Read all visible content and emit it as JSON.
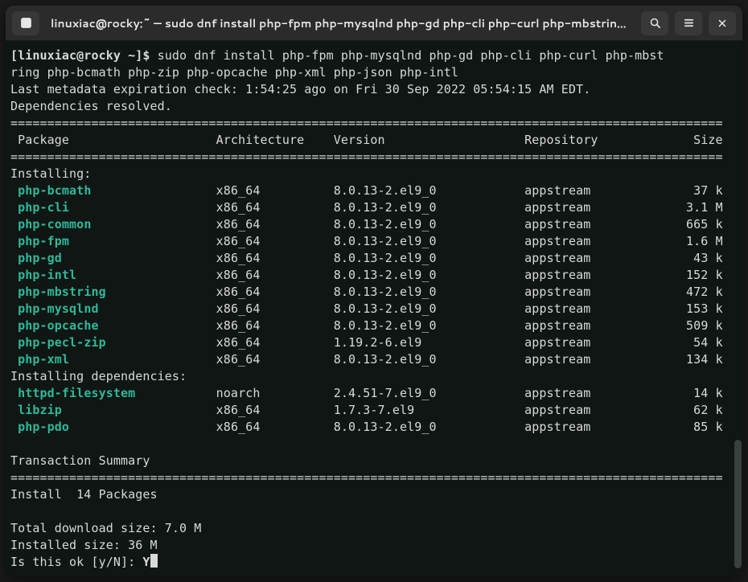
{
  "titlebar": {
    "title": "linuxiac@rocky:~ — sudo dnf install php-fpm php-mysqlnd php-gd php-cli php-curl php-mbstring p…"
  },
  "prompt": {
    "label": "[linuxiac@rocky ~]$",
    "command_line1": " sudo dnf install php-fpm php-mysqlnd php-gd php-cli php-curl php-mbst",
    "command_line2": "ring php-bcmath php-zip php-opcache php-xml php-json php-intl"
  },
  "meta_line": "Last metadata expiration check: 1:54:25 ago on Fri 30 Sep 2022 05:54:15 AM EDT.",
  "deps_resolved": "Dependencies resolved.",
  "header": {
    "package": " Package",
    "arch": "Architecture",
    "version": "Version",
    "repo": "Repository",
    "size": "Size"
  },
  "section_installing": "Installing:",
  "installing": [
    {
      "name": "php-bcmath",
      "arch": "x86_64",
      "version": "8.0.13-2.el9_0",
      "repo": "appstream",
      "size": "37 k"
    },
    {
      "name": "php-cli",
      "arch": "x86_64",
      "version": "8.0.13-2.el9_0",
      "repo": "appstream",
      "size": "3.1 M"
    },
    {
      "name": "php-common",
      "arch": "x86_64",
      "version": "8.0.13-2.el9_0",
      "repo": "appstream",
      "size": "665 k"
    },
    {
      "name": "php-fpm",
      "arch": "x86_64",
      "version": "8.0.13-2.el9_0",
      "repo": "appstream",
      "size": "1.6 M"
    },
    {
      "name": "php-gd",
      "arch": "x86_64",
      "version": "8.0.13-2.el9_0",
      "repo": "appstream",
      "size": "43 k"
    },
    {
      "name": "php-intl",
      "arch": "x86_64",
      "version": "8.0.13-2.el9_0",
      "repo": "appstream",
      "size": "152 k"
    },
    {
      "name": "php-mbstring",
      "arch": "x86_64",
      "version": "8.0.13-2.el9_0",
      "repo": "appstream",
      "size": "472 k"
    },
    {
      "name": "php-mysqlnd",
      "arch": "x86_64",
      "version": "8.0.13-2.el9_0",
      "repo": "appstream",
      "size": "153 k"
    },
    {
      "name": "php-opcache",
      "arch": "x86_64",
      "version": "8.0.13-2.el9_0",
      "repo": "appstream",
      "size": "509 k"
    },
    {
      "name": "php-pecl-zip",
      "arch": "x86_64",
      "version": "1.19.2-6.el9",
      "repo": "appstream",
      "size": "54 k"
    },
    {
      "name": "php-xml",
      "arch": "x86_64",
      "version": "8.0.13-2.el9_0",
      "repo": "appstream",
      "size": "134 k"
    }
  ],
  "section_deps": "Installing dependencies:",
  "deps": [
    {
      "name": "httpd-filesystem",
      "arch": "noarch",
      "version": "2.4.51-7.el9_0",
      "repo": "appstream",
      "size": "14 k"
    },
    {
      "name": "libzip",
      "arch": "x86_64",
      "version": "1.7.3-7.el9",
      "repo": "appstream",
      "size": "62 k"
    },
    {
      "name": "php-pdo",
      "arch": "x86_64",
      "version": "8.0.13-2.el9_0",
      "repo": "appstream",
      "size": "85 k"
    }
  ],
  "transaction_summary": "Transaction Summary",
  "install_count": "Install  14 Packages",
  "total_dl": "Total download size: 7.0 M",
  "installed_size": "Installed size: 36 M",
  "confirm_label": "Is this ok [y/N]: ",
  "confirm_input": "Y"
}
